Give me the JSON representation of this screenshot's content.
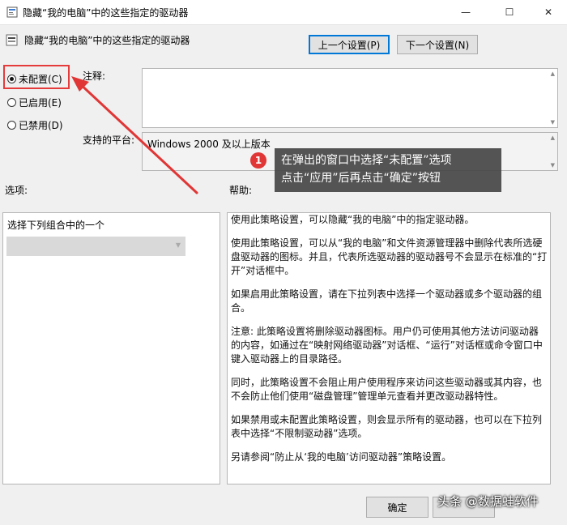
{
  "window": {
    "title": "隐藏“我的电脑”中的这些指定的驱动器",
    "minimize_glyph": "—",
    "maximize_glyph": "☐",
    "close_glyph": "✕"
  },
  "policy": {
    "title": "隐藏“我的电脑”中的这些指定的驱动器",
    "prev_button": "上一个设置(P)",
    "next_button": "下一个设置(N)"
  },
  "state_options": [
    {
      "label": "未配置(C)",
      "selected": true
    },
    {
      "label": "已启用(E)",
      "selected": false
    },
    {
      "label": "已禁用(D)",
      "selected": false
    }
  ],
  "comment": {
    "label": "注释:",
    "value": ""
  },
  "platform": {
    "label": "支持的平台:",
    "value": "Windows 2000 及以上版本"
  },
  "options": {
    "label": "选项:",
    "combo_caption": "选择下列组合中的一个",
    "combo_value": ""
  },
  "help": {
    "label": "帮助:",
    "paragraphs": [
      "使用此策略设置，可以隐藏“我的电脑”中的指定驱动器。",
      "使用此策略设置，可以从“我的电脑”和文件资源管理器中删除代表所选硬盘驱动器的图标。并且，代表所选驱动器的驱动器号不会显示在标准的“打开”对话框中。",
      "如果启用此策略设置，请在下拉列表中选择一个驱动器或多个驱动器的组合。",
      "注意: 此策略设置将删除驱动器图标。用户仍可使用其他方法访问驱动器的内容，如通过在“映射网络驱动器”对话框、“运行”对话框或命令窗口中键入驱动器上的目录路径。",
      "同时，此策略设置不会阻止用户使用程序来访问这些驱动器或其内容，也不会防止他们使用“磁盘管理”管理单元查看并更改驱动器特性。",
      "如果禁用或未配置此策略设置，则会显示所有的驱动器，也可以在下拉列表中选择“不限制驱动器”选项。",
      "另请参阅“防止从‘我的电脑’访问驱动器”策略设置。"
    ]
  },
  "annotation": {
    "badge": "1",
    "line1": "在弹出的窗口中选择“未配置”选项",
    "line2": "点击“应用”后再点击“确定”按钮",
    "accent_color": "#e03636"
  },
  "footer": {
    "ok_button": "确定",
    "watermark": "头条 @数据蛙软件"
  }
}
